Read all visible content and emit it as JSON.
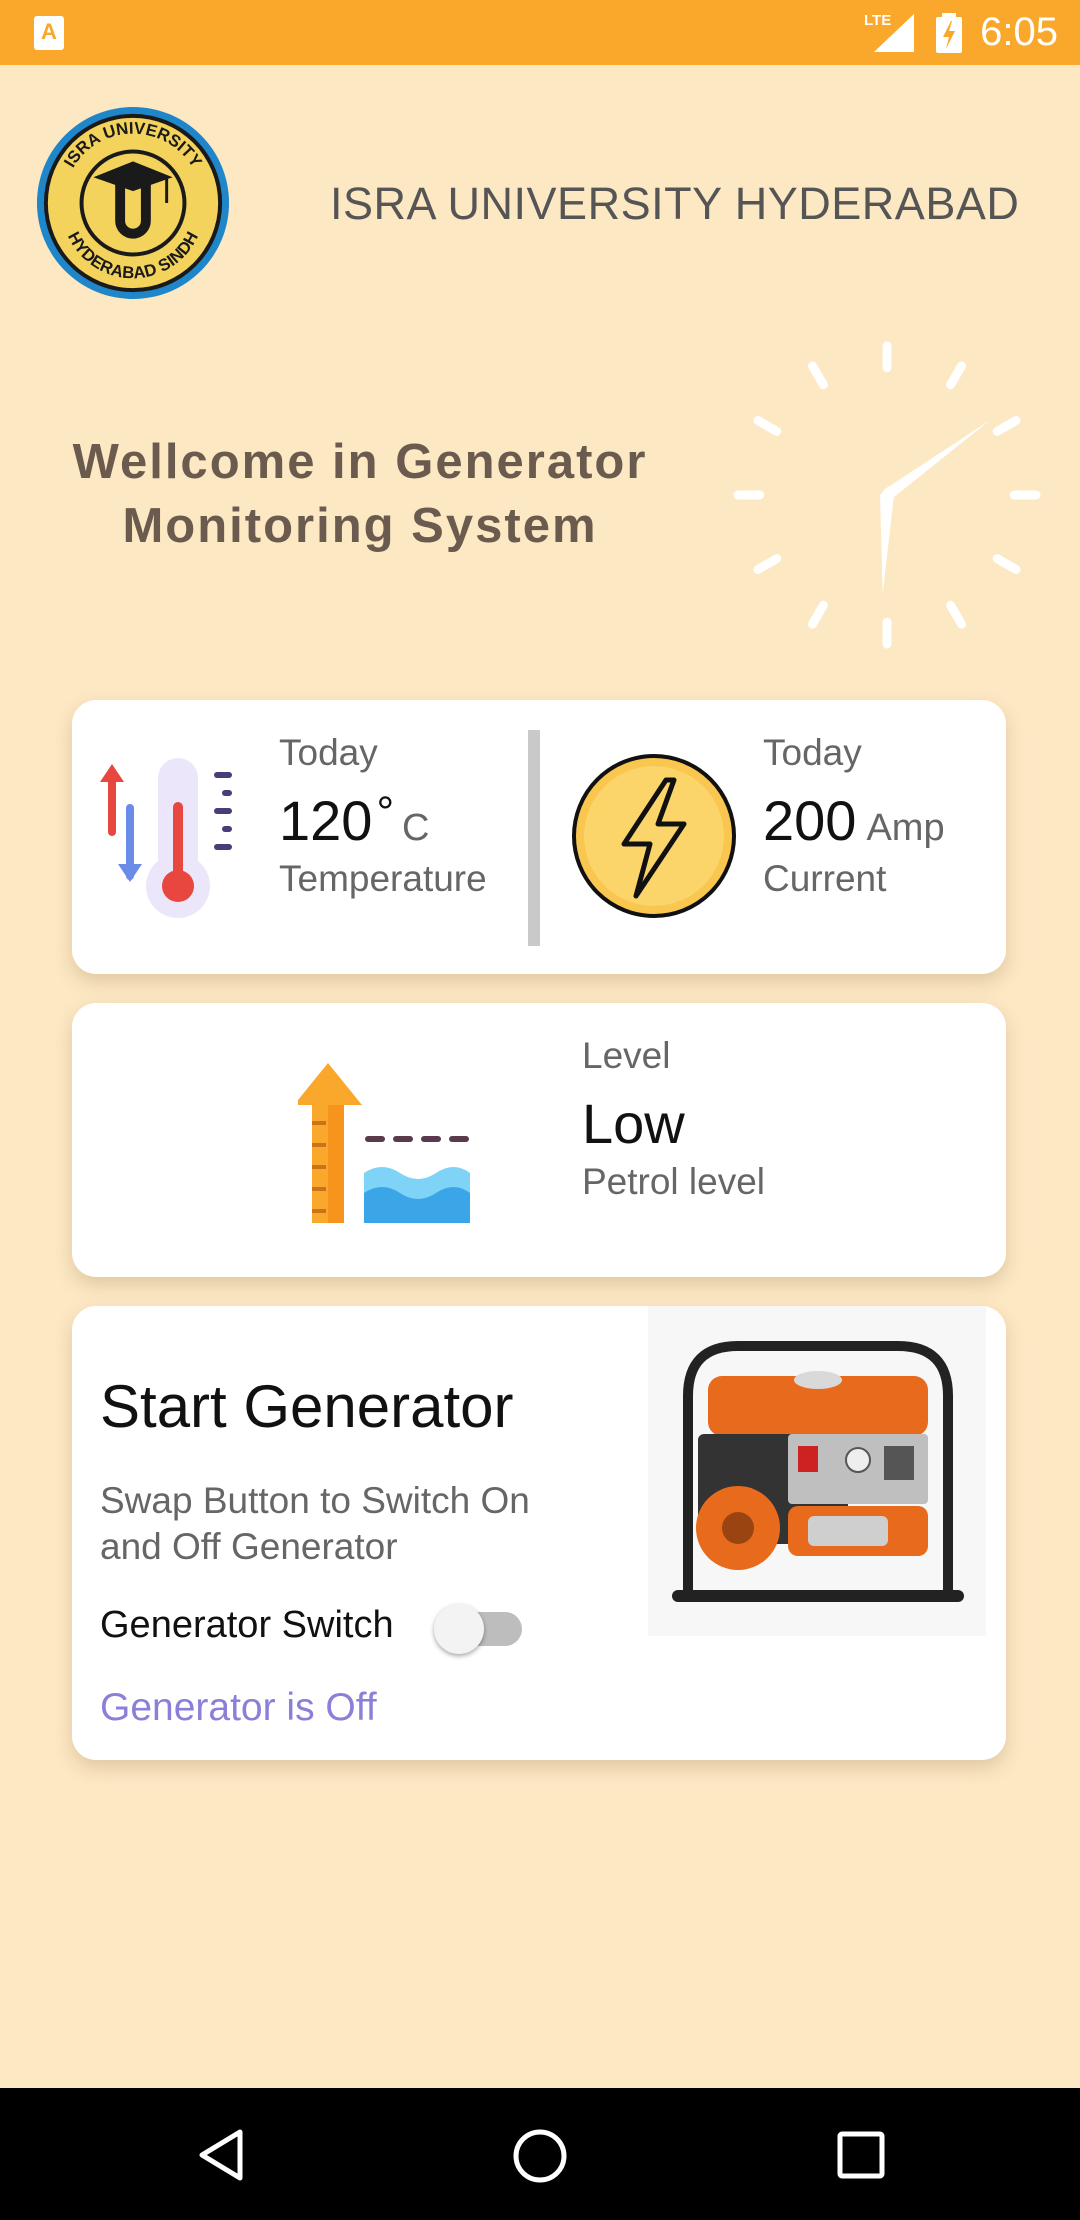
{
  "status_bar": {
    "time": "6:05",
    "network": "LTE",
    "app_icon_letter": "A",
    "background": "#F9A82B"
  },
  "header": {
    "university": "ISRA UNIVERSITY HYDERABAD",
    "logo_top_text": "ISRA UNIVERSITY",
    "logo_bottom_text": "HYDERABAD SINDH"
  },
  "welcome": {
    "line1": "Wellcome in Generator",
    "line2": "Monitoring System"
  },
  "clock": {
    "hour_value": 6,
    "minute_value": 5
  },
  "temperature": {
    "caption": "Today",
    "value": "120",
    "degree": "°",
    "unit": "C",
    "label": "Temperature"
  },
  "current": {
    "caption": "Today",
    "value": "200",
    "unit": "Amp",
    "label": "Current"
  },
  "petrol": {
    "caption": "Level",
    "value": "Low",
    "label": "Petrol level"
  },
  "generator": {
    "title": "Start Generator",
    "description": "Swap Button to Switch On and Off Generator",
    "switch_label": "Generator Switch",
    "switch_on": false,
    "status": "Generator is Off"
  },
  "colors": {
    "background": "#FDE8C4",
    "status_text": "#8a7fd9",
    "accent": "#F9A82B"
  },
  "icons": {
    "temperature": "thermometer-icon",
    "current": "lightning-bolt-icon",
    "petrol": "fuel-level-icon",
    "navigation": [
      "back-icon",
      "home-icon",
      "recent-apps-icon"
    ]
  }
}
